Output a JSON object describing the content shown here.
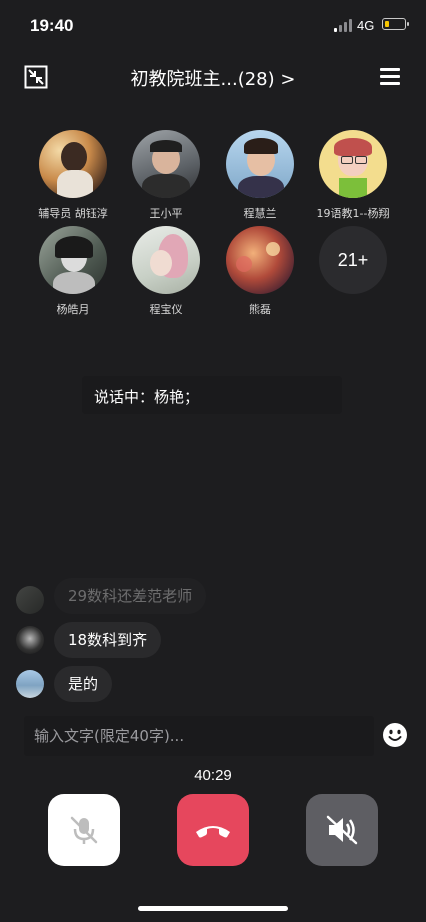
{
  "status_bar": {
    "time": "19:40",
    "network": "4G",
    "battery_level": 0.2
  },
  "header": {
    "title": "初教院班主...(28) >",
    "shrink_icon": "shrink-window-icon",
    "menu_icon": "hamburger-menu-icon"
  },
  "members": [
    {
      "name": "辅导员 胡钰淳"
    },
    {
      "name": "王小平"
    },
    {
      "name": "程慧兰"
    },
    {
      "name": "19语教1--杨翔"
    },
    {
      "name": "杨皓月"
    },
    {
      "name": "程宝仪"
    },
    {
      "name": "熊磊"
    }
  ],
  "more_members": "21+",
  "speaking": {
    "text": "说话中：杨艳；"
  },
  "chat": [
    {
      "text": "29数科还差范老师"
    },
    {
      "text": "18数科到齐"
    },
    {
      "text": "是的"
    }
  ],
  "input": {
    "placeholder": "输入文字(限定40字)...",
    "value": ""
  },
  "call": {
    "duration": "40:29"
  },
  "colors": {
    "background": "#1d1d1f",
    "hangup": "#e6475d",
    "speaker": "#5e5e63",
    "mute": "#ffffff"
  }
}
